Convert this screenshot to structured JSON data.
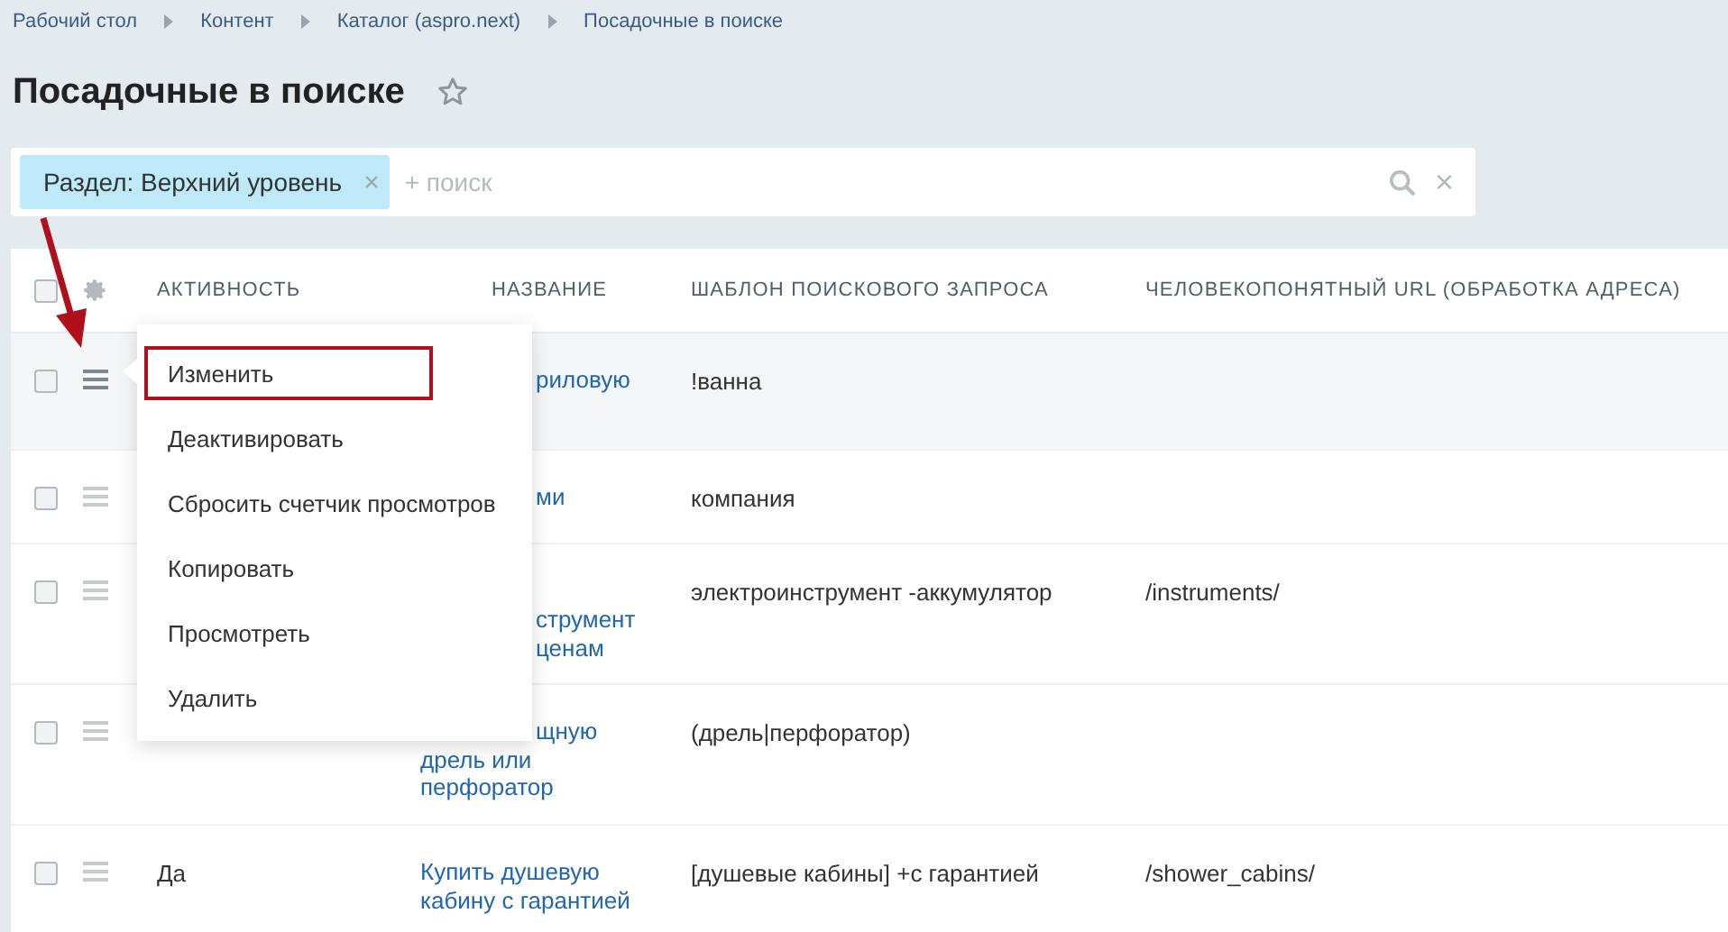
{
  "breadcrumbs": [
    "Рабочий стол",
    "Контент",
    "Каталог (aspro.next)",
    "Посадочные в поиске"
  ],
  "title": "Посадочные в поиске",
  "filter": {
    "chip": "Раздел: Верхний уровень",
    "chip_close": "×",
    "placeholder": "+ поиск",
    "clear": "×"
  },
  "table": {
    "columns": [
      "АКТИВНОСТЬ",
      "НАЗВАНИЕ",
      "ШАБЛОН ПОИСКОВОГО ЗАПРОСА",
      "ЧЕЛОВЕКОПОНЯТНЫЙ URL (ОБРАБОТКА АДРЕСА)"
    ],
    "select_all_checked": false,
    "rows": [
      {
        "checked": false,
        "highlighted": true,
        "name_tail": [
          "риловую"
        ],
        "template": "!ванна"
      },
      {
        "checked": false,
        "highlighted": false,
        "name_tail": [
          "ми"
        ],
        "template": "компания"
      },
      {
        "checked": false,
        "highlighted": false,
        "name_tail": [
          "струмент",
          "ценам"
        ],
        "template": "электроинструмент -аккумулятор",
        "url": "/instruments/"
      },
      {
        "checked": false,
        "highlighted": false,
        "name_tail": [
          "щную"
        ],
        "name": [
          "дрель или",
          "перфоратор"
        ],
        "template": "(дрель|перфоратор)"
      },
      {
        "checked": false,
        "highlighted": false,
        "active": "Да",
        "name": [
          "Купить душевую",
          "кабину с гарантией"
        ],
        "template": "[душевые кабины] +с гарантией",
        "url": "/shower_cabins/"
      }
    ]
  },
  "menu": [
    {
      "label": "Изменить",
      "highlighted": true
    },
    {
      "label": "Деактивировать",
      "highlighted": false
    },
    {
      "label": "Сбросить счетчик просмотров",
      "highlighted": false
    },
    {
      "label": "Копировать",
      "highlighted": false
    },
    {
      "label": "Просмотреть",
      "highlighted": false
    },
    {
      "label": "Удалить",
      "highlighted": false
    }
  ]
}
